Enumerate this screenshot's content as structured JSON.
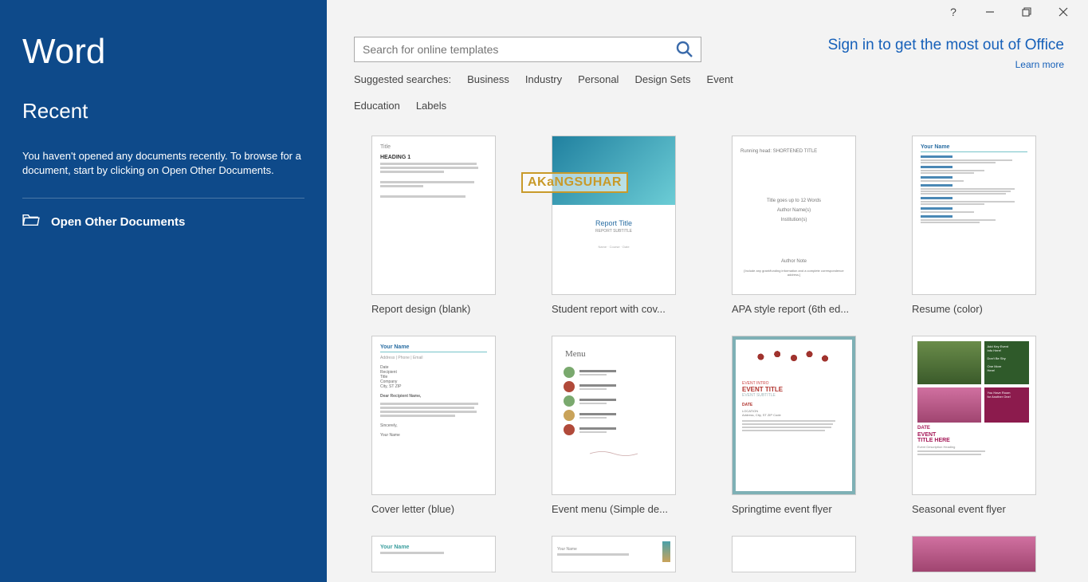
{
  "app": {
    "title": "Word"
  },
  "sidebar": {
    "recent_heading": "Recent",
    "no_docs_text": "You haven't opened any documents recently. To browse for a document, start by clicking on Open Other Documents.",
    "open_other_label": "Open Other Documents"
  },
  "topright": {
    "signin": "Sign in to get the most out of Office",
    "learn_more": "Learn more"
  },
  "search": {
    "placeholder": "Search for online templates"
  },
  "suggested": {
    "label": "Suggested searches:",
    "items": [
      "Business",
      "Industry",
      "Personal",
      "Design Sets",
      "Event",
      "Education",
      "Labels"
    ]
  },
  "templates": [
    {
      "label": "Report design (blank)"
    },
    {
      "label": "Student report with cov..."
    },
    {
      "label": "APA style report (6th ed..."
    },
    {
      "label": "Resume (color)"
    },
    {
      "label": "Cover letter (blue)"
    },
    {
      "label": "Event menu (Simple de..."
    },
    {
      "label": "Springtime event flyer"
    },
    {
      "label": "Seasonal event flyer"
    }
  ],
  "watermark": "AKaNGSUHAR"
}
